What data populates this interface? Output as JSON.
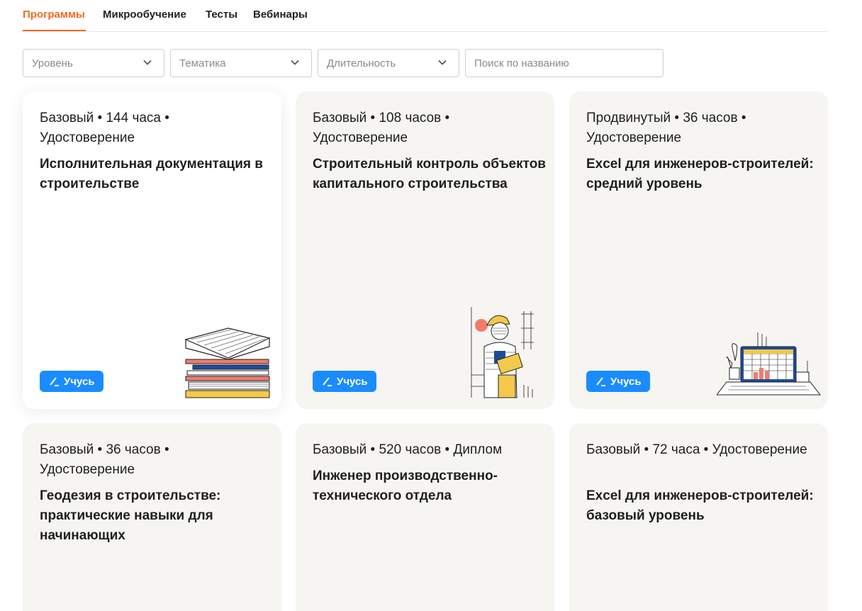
{
  "tabs": [
    {
      "label": "Программы",
      "active": true
    },
    {
      "label": "Микрообучение",
      "active": false
    },
    {
      "label": "Тесты",
      "active": false
    },
    {
      "label": "Вебинары",
      "active": false
    }
  ],
  "filters": {
    "level": "Уровень",
    "topic": "Тематика",
    "duration": "Длительность",
    "search_placeholder": "Поиск по названию"
  },
  "learn_label": "Учусь",
  "colors": {
    "accent": "#f26b1d",
    "button": "#1a8cff",
    "card_bg": "#f6f5f2"
  },
  "cards": [
    {
      "meta": "Базовый • 144 часа • Удостоверение",
      "title": "Исполнительная документация в строительстве",
      "icon": "document-stack-icon"
    },
    {
      "meta": "Базовый • 108 часов • Удостоверение",
      "title": "Строительный контроль объектов капитального строительства",
      "icon": "builder-with-clipboard-icon"
    },
    {
      "meta": "Продвинутый • 36 часов • Удостоверение",
      "title": "Excel для инженеров-строителей: средний уровень",
      "icon": "laptop-chart-icon"
    },
    {
      "meta": "Базовый • 36 часов • Удостоверение",
      "title": "Геодезия в строительстве: практические навыки для начинающих"
    },
    {
      "meta": "Базовый • 520 часов • Диплом",
      "title": "Инженер производственно-технического отдела"
    },
    {
      "meta": "Базовый • 72 часа • Удостоверение",
      "title": "Excel для инженеров-строителей: базовый уровень"
    }
  ]
}
